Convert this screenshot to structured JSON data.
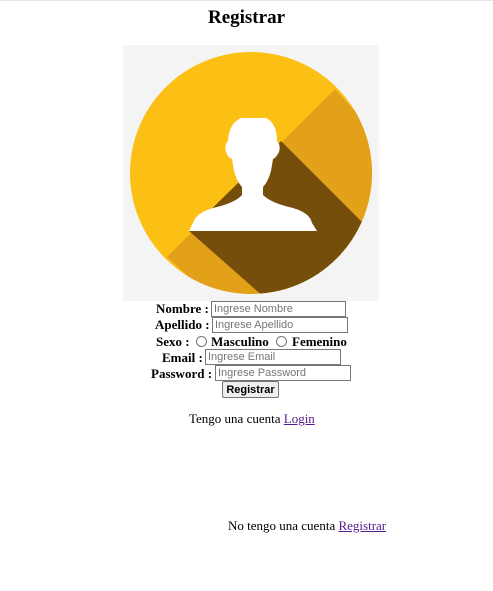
{
  "page": {
    "title": "Registrar"
  },
  "form": {
    "nombre_label": "Nombre :",
    "nombre_placeholder": "Ingrese Nombre",
    "apellido_label": "Apellido :",
    "apellido_placeholder": "Ingrese Apellido",
    "sexo_label": "Sexo :",
    "sexo_options": [
      "Masculino",
      "Femenino"
    ],
    "email_label": "Email :",
    "email_placeholder": "Ingrese Email",
    "password_label": "Password :",
    "password_placeholder": "Ingrese Password",
    "submit_label": "Registrar"
  },
  "login_prompt": {
    "text": "Tengo una cuenta",
    "link": "Login"
  },
  "register_prompt": {
    "text": "No tengo una cuenta",
    "link": "Registrar"
  },
  "colors": {
    "avatar_circle": "#fcbf14",
    "avatar_shadow_light": "#e3a11a",
    "avatar_shadow_dark": "#744e0a",
    "avatar_background": "#f4f4f4",
    "visited_link": "#551a8b"
  },
  "icons": {
    "avatar": "user-silhouette-icon"
  }
}
